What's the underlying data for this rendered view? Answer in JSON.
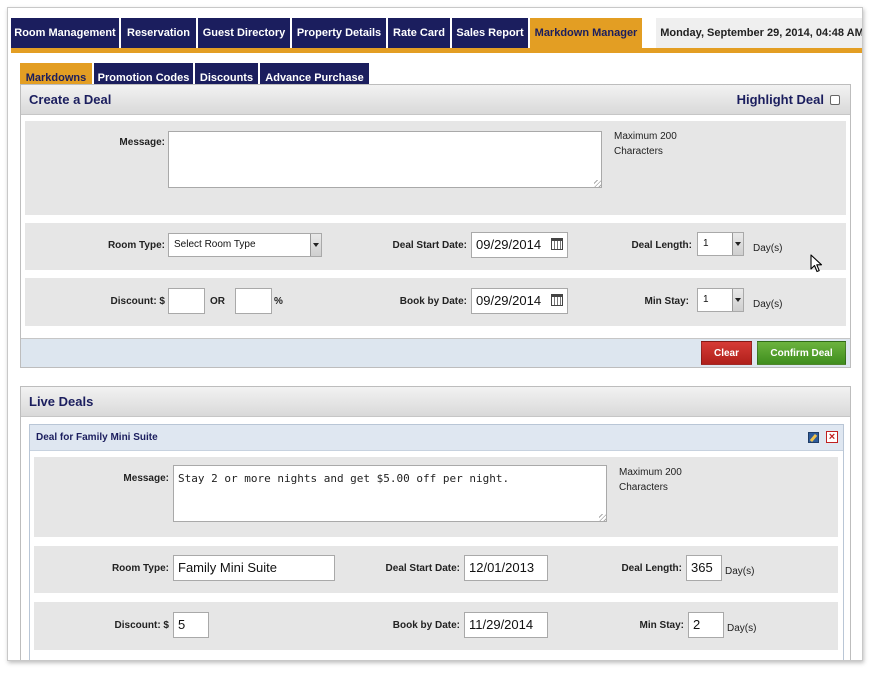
{
  "topnav": {
    "tabs": [
      {
        "label": "Room Management"
      },
      {
        "label": "Reservation"
      },
      {
        "label": "Guest Directory"
      },
      {
        "label": "Property Details"
      },
      {
        "label": "Rate Card"
      },
      {
        "label": "Sales Report"
      },
      {
        "label": "Markdown Manager",
        "active": true
      }
    ],
    "datetime": "Monday, September 29, 2014, 04:48 AM"
  },
  "subnav": {
    "tabs": [
      {
        "label": "Markdowns",
        "active": true
      },
      {
        "label": "Promotion Codes"
      },
      {
        "label": "Discounts"
      },
      {
        "label": "Advance Purchase"
      }
    ]
  },
  "create": {
    "title": "Create a Deal",
    "highlight_label": "Highlight Deal",
    "highlight_checked": false,
    "message_label": "Message:",
    "message_value": "",
    "max_note_line1": "Maximum 200",
    "max_note_line2": "Characters",
    "room_type_label": "Room Type:",
    "room_type_value": "Select Room Type",
    "start_label": "Deal Start Date:",
    "start_value": "09/29/2014",
    "length_label": "Deal Length:",
    "length_value": "1",
    "days_unit": "Day(s)",
    "discount_label": "Discount: $",
    "discount_value": "",
    "or_label": "OR",
    "percent_value": "",
    "percent_sign": "%",
    "book_label": "Book by Date:",
    "book_value": "09/29/2014",
    "min_stay_label": "Min Stay:",
    "min_stay_value": "1",
    "clear_button": "Clear",
    "confirm_button": "Confirm Deal"
  },
  "live": {
    "title": "Live Deals",
    "deal": {
      "title": "Deal for Family Mini Suite",
      "message_label": "Message:",
      "message_value": "Stay 2 or more nights and get $5.00 off per night.",
      "max_note_line1": "Maximum 200",
      "max_note_line2": "Characters",
      "room_type_label": "Room Type:",
      "room_type_value": "Family Mini Suite",
      "start_label": "Deal Start Date:",
      "start_value": "12/01/2013",
      "length_label": "Deal Length:",
      "length_value": "365",
      "days_unit": "Day(s)",
      "discount_label": "Discount: $",
      "discount_value": "5",
      "book_label": "Book by Date:",
      "book_value": "11/29/2014",
      "min_stay_label": "Min Stay:",
      "min_stay_value": "2"
    }
  },
  "colors": {
    "nav": "#1b1e5e",
    "accent": "#e39e23",
    "clear": "#c62b26",
    "confirm": "#56a230"
  },
  "icons": [
    "calendar-icon",
    "edit-icon",
    "delete-icon",
    "mouse-pointer-icon"
  ]
}
